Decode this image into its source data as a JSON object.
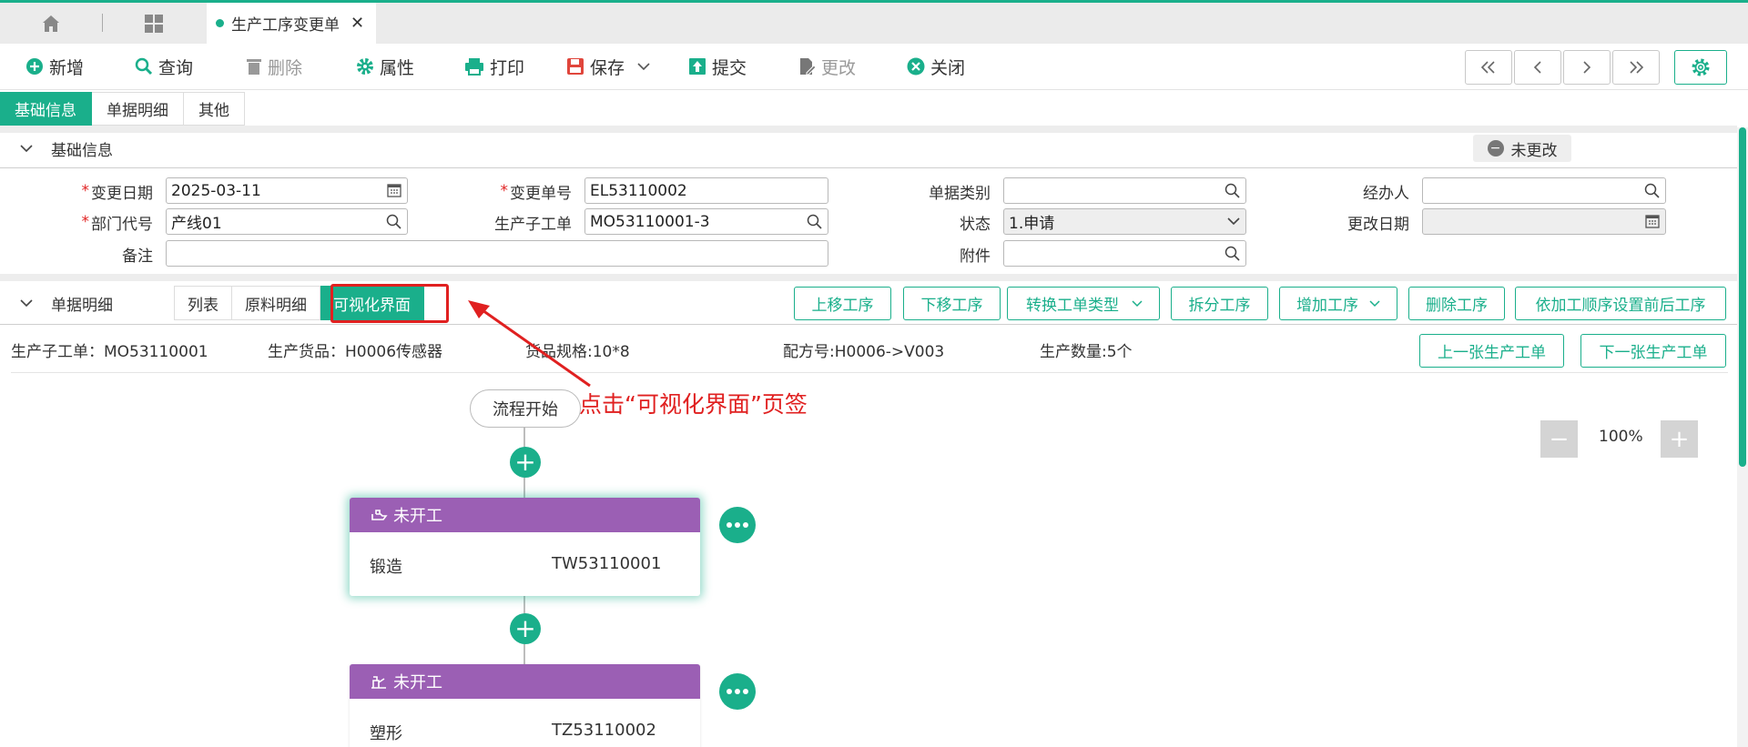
{
  "tabs": {
    "doc_tab_label": "生产工序变更单"
  },
  "toolbar": {
    "new": "新增",
    "query": "查询",
    "delete": "删除",
    "properties": "属性",
    "print": "打印",
    "save": "保存",
    "submit": "提交",
    "modify": "更改",
    "close": "关闭"
  },
  "section_tabs": [
    "基础信息",
    "单据明细",
    "其他"
  ],
  "basic": {
    "title": "基础信息",
    "status_badge": "未更改",
    "fields": {
      "change_date_label": "变更日期",
      "change_date_value": "2025-03-11",
      "change_no_label": "变更单号",
      "change_no_value": "EL53110002",
      "doc_type_label": "单据类别",
      "doc_type_value": "",
      "handler_label": "经办人",
      "handler_value": "",
      "dept_label": "部门代号",
      "dept_value": "产线01",
      "sub_order_label": "生产子工单",
      "sub_order_value": "MO53110001-3",
      "status_label": "状态",
      "status_value": "1.申请",
      "change_date2_label": "更改日期",
      "change_date2_value": "",
      "remark_label": "备注",
      "remark_value": "",
      "attachment_label": "附件",
      "attachment_value": ""
    }
  },
  "detail": {
    "title": "单据明细",
    "subtabs": [
      "列表",
      "原料明细",
      "可视化界面"
    ],
    "buttons": {
      "move_up": "上移工序",
      "move_down": "下移工序",
      "convert_type": "转换工单类型",
      "split": "拆分工序",
      "add": "增加工序",
      "remove": "删除工序",
      "set_order": "依加工顺序设置前后工序",
      "prev_order": "上一张生产工单",
      "next_order": "下一张生产工单"
    },
    "info": {
      "sub_order": "生产子工单：MO53110001",
      "goods": "生产货品：H0006传感器",
      "spec": "货品规格:10*8",
      "formula": "配方号:H0006->V003",
      "quantity": "生产数量:5个"
    }
  },
  "canvas": {
    "callout": "点击“可视化界面”页签",
    "zoom": "100%",
    "flow_start": "流程开始",
    "steps": [
      {
        "status": "未开工",
        "name": "锻造",
        "code": "TW53110001"
      },
      {
        "status": "未开工",
        "name": "塑形",
        "code": "TZ53110002"
      }
    ]
  },
  "colors": {
    "accent": "#1aaf8b",
    "card_header": "#9b5fb4",
    "annotation": "#e02020"
  }
}
